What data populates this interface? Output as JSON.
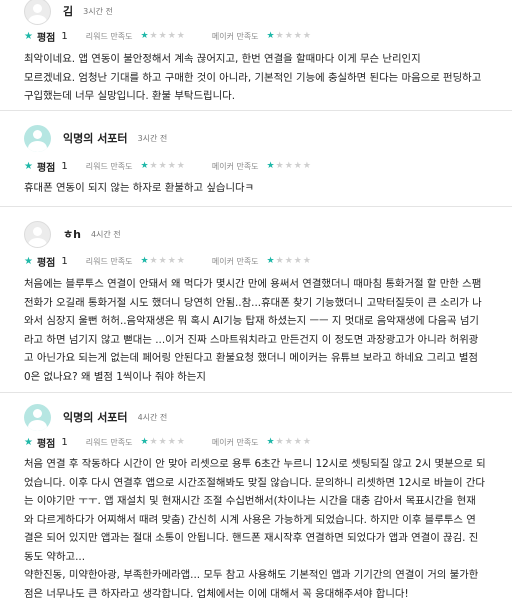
{
  "reviews": [
    {
      "name": "김",
      "time": "3시간 전",
      "rating_label": "평점",
      "rating_value": "1",
      "ridewide_label": "리워드 만족도",
      "maker_label": "메이커 만족도",
      "ridewide_stars": 1,
      "maker_stars": 1,
      "text": "최악이네요. 앱 연동이 불안정해서 계속 끊어지고, 한번 연결을 할때마다 이게 무슨 난리인지\n모르겠네요. 엄청난 기대를 하고 구매한 것이 아니라, 기본적인 기능에 충실하면 된다는 마음으로 펀딩하고\n구입했는데 너무 실망입니다. 환불 부탁드립니다."
    },
    {
      "name": "익명의 서포터",
      "time": "3시간 전",
      "rating_label": "평점",
      "rating_value": "1",
      "ridewide_label": "리워드 만족도",
      "maker_label": "메이커 만족도",
      "ridewide_stars": 1,
      "maker_stars": 1,
      "text": "휴대폰 연동이 되지 않는 하자로 환불하고 싶습니다ㅋ"
    },
    {
      "name": "ㅎh",
      "time": "4시간 전",
      "rating_label": "평점",
      "rating_value": "1",
      "ridewide_label": "리워드 만족도",
      "maker_label": "메이커 만족도",
      "ridewide_stars": 1,
      "maker_stars": 1,
      "text": "처음에는 블루투스 연결이 안돼서 왜 먹다가 몇시간 만에 용써서 연결했더니 때마침 통화거절 할 만한 스팸\n전화가 오길래 통화거절 시도 했더니 당연히 안됨..참...휴대폰 찾기 기능했더니 고막터질듯이 큰 소리가 나\n와서 심장지 울뻔 허허..음악재생은 뭐 혹시 AI기능 탑재 하셨는지 ㅡㅡ 지 멋대로 음악재생에 다음곡 넘기\n라고 하면 넘기지 않고 뻗대는 ...이거 진짜 스마트워치라고 만든건지 이 정도면 과장광고가 아니라 허위광\n고 아닌가요 되는게 없는데 페어링 안된다고 환불요청 했더니 메이커는 유튜브 보라고 하네요 그리고 별점\n0은 없나요? 왜 별점 1씩이나 줘야 하는지"
    },
    {
      "name": "익명의 서포터",
      "time": "4시간 전",
      "rating_label": "평점",
      "rating_value": "1",
      "ridewide_label": "리워드 만족도",
      "maker_label": "메이커 만족도",
      "ridewide_stars": 1,
      "maker_stars": 1,
      "text": "처음 연결 후 작동하다 시간이 안 맞아 리셋으로 용투 6초간 누르니 12시로 셋팅되질 않고 2시 몇분으로 되\n었습니다. 이후 다시 연결후 앱으로 시간조절해봐도 맞질 않습니다. 문의하니 리셋하면 12시로 바늘이 간다\n는 이야기만 ㅜㅜ. 앱 재설치 및 현재시간 조절 수십번해서(차이나는 시간을 대충 감아서 목표시간을 현재\n와 다르게하다가 어찌해서 때려 맞춤) 간신히 시계 사용은 가능하게 되었습니다. 하지만 이후 블루투스 연\n결은 되어 있지만 앱과는 절대 소통이 안됩니다. 핸드폰 재시작후 연결하면 되었다가 앱과 연결이 끊김. 진\n동도 약하고...\n약한진동, 미약한아광, 부족한카메라앱... 모두 참고 사용해도 기본적인 앱과 기기간의 연결이 거의 불가한\n점은 너무나도 큰 하자라고 생각합니다. 업체에서는 이에 대해서 꼭 응대해주셔야 합니다!"
    }
  ],
  "colors": {
    "accent": "#1fb8a8",
    "star_off": "#cfcfcf",
    "divider": "#e4e4e4"
  }
}
